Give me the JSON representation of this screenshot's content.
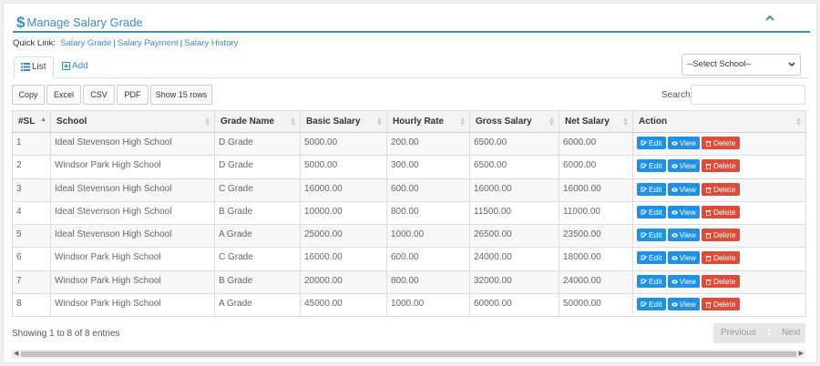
{
  "header": {
    "icon": "dollar-icon",
    "title": "Manage Salary Grade"
  },
  "quick_links": {
    "label": "Quick Link:",
    "links": [
      "Salary Grade",
      "Salary Payment",
      "Salary History"
    ],
    "separator": "|"
  },
  "tabs": [
    {
      "label": "List",
      "icon": "list-icon"
    },
    {
      "label": "Add",
      "icon": "plus-box-icon"
    }
  ],
  "school_select": {
    "value": "--Select School--"
  },
  "export_buttons": [
    "Copy",
    "Excel",
    "CSV",
    "PDF",
    "Show 15 rows"
  ],
  "search": {
    "label": "Search:",
    "value": ""
  },
  "table": {
    "columns": [
      "#SL",
      "School",
      "Grade Name",
      "Basic Salary",
      "Hourly Rate",
      "Gross Salary",
      "Net Salary",
      "Action"
    ],
    "rows": [
      [
        "1",
        "Ideal Stevenson High School",
        "D Grade",
        "5000.00",
        "200.00",
        "6500.00",
        "6000.00"
      ],
      [
        "2",
        "Windsor Park High School",
        "D Grade",
        "5000.00",
        "300.00",
        "6500.00",
        "6000.00"
      ],
      [
        "3",
        "Ideal Stevenson High School",
        "C Grade",
        "16000.00",
        "600.00",
        "16000.00",
        "16000.00"
      ],
      [
        "4",
        "Ideal Stevenson High School",
        "B Grade",
        "10000.00",
        "800.00",
        "11500.00",
        "11000.00"
      ],
      [
        "5",
        "Ideal Stevenson High School",
        "A Grade",
        "25000.00",
        "1000.00",
        "26500.00",
        "23500.00"
      ],
      [
        "6",
        "Windsor Park High School",
        "C Grade",
        "16000.00",
        "600.00",
        "24000.00",
        "18000.00"
      ],
      [
        "7",
        "Windsor Park High School",
        "B Grade",
        "20000.00",
        "800.00",
        "32000.00",
        "24000.00"
      ],
      [
        "8",
        "Windsor Park High School",
        "A Grade",
        "45000.00",
        "1000.00",
        "60000.00",
        "50000.00"
      ]
    ],
    "actions": [
      "Edit",
      "View",
      "Delete"
    ]
  },
  "footer": {
    "info": "Showing 1 to 8 of 8 entries",
    "prev": "Previous",
    "page": "1",
    "next": "Next"
  },
  "colors": {
    "accent": "#3c8dbc",
    "primary_btn": "#1e90e6",
    "danger_btn": "#dd4b39"
  }
}
